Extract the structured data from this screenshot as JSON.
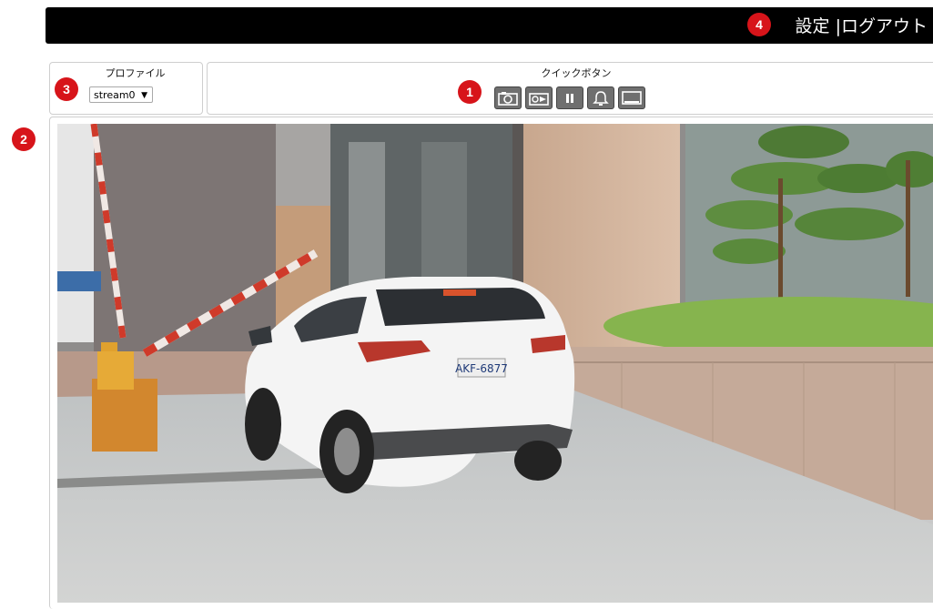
{
  "header": {
    "settings_label": "設定",
    "separator": "|",
    "logout_label": "ログアウト"
  },
  "profile": {
    "title": "プロファイル",
    "selected_stream": "stream0"
  },
  "quick_buttons": {
    "title": "クイックボタン",
    "icons": [
      "snapshot-icon",
      "record-icon",
      "pause-icon",
      "alarm-bell-icon",
      "display-icon"
    ]
  },
  "badges": {
    "quick_buttons": "1",
    "video": "2",
    "profile": "3",
    "settings": "4"
  },
  "video": {
    "license_plate": "AKF-6877"
  },
  "colors": {
    "badge": "#d7141a",
    "topbar": "#000000",
    "button": "#6f6f6f"
  }
}
